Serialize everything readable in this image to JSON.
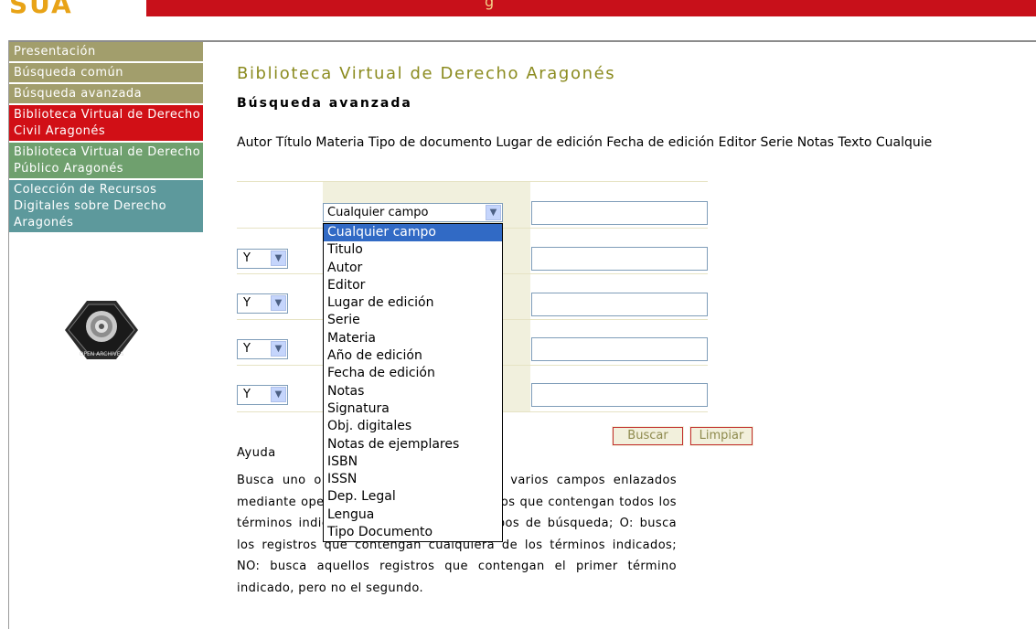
{
  "header": {
    "fragment": "g"
  },
  "sidebar": {
    "items": [
      {
        "label": "Presentación"
      },
      {
        "label": "Búsqueda común"
      },
      {
        "label": "Búsqueda avanzada"
      },
      {
        "label": "Biblioteca Virtual de Derecho Civil Aragonés"
      },
      {
        "label": "Biblioteca Virtual de Derecho Público Aragonés"
      },
      {
        "label": "Colección de Recursos Digitales sobre Derecho Aragonés"
      }
    ],
    "logo_text": "OPEN ARCHIVES"
  },
  "main": {
    "title": "Biblioteca Virtual de Derecho Aragonés",
    "subtitle": "Búsqueda avanzada",
    "fields_line": "Autor Título Materia Tipo de documento Lugar de edición Fecha de edición Editor Serie Notas Texto Cualquie",
    "field_select_value": "Cualquier campo",
    "operator_values": [
      "Y",
      "Y",
      "Y",
      "Y"
    ],
    "dropdown_options": [
      "Cualquier campo",
      "Titulo",
      "Autor",
      "Editor",
      "Lugar de edición",
      "Serie",
      "Materia",
      "Año de edición",
      "Fecha de edición",
      "Notas",
      "Signatura",
      "Obj. digitales",
      "Notas de ejemplares",
      "ISBN",
      "ISSN",
      "Dep. Legal",
      "Lengua",
      "Tipo Documento"
    ],
    "search_button": "Buscar",
    "clear_button": "Limpiar",
    "help_title": "Ayuda",
    "help_text": "Busca uno o varios términos en uno o varios campos enlazados mediante operadores. Y: busca los registros que contengan todos los términos indicados en los distintos campos de búsqueda; O: busca los registros que contengan cualquiera de los términos indicados; NO: busca aquellos registros que contengan el primer término indicado, pero no el segundo."
  },
  "colors": {
    "title": "#8b8b1f",
    "header_red": "#c8101a",
    "selected": "#316ac5"
  }
}
